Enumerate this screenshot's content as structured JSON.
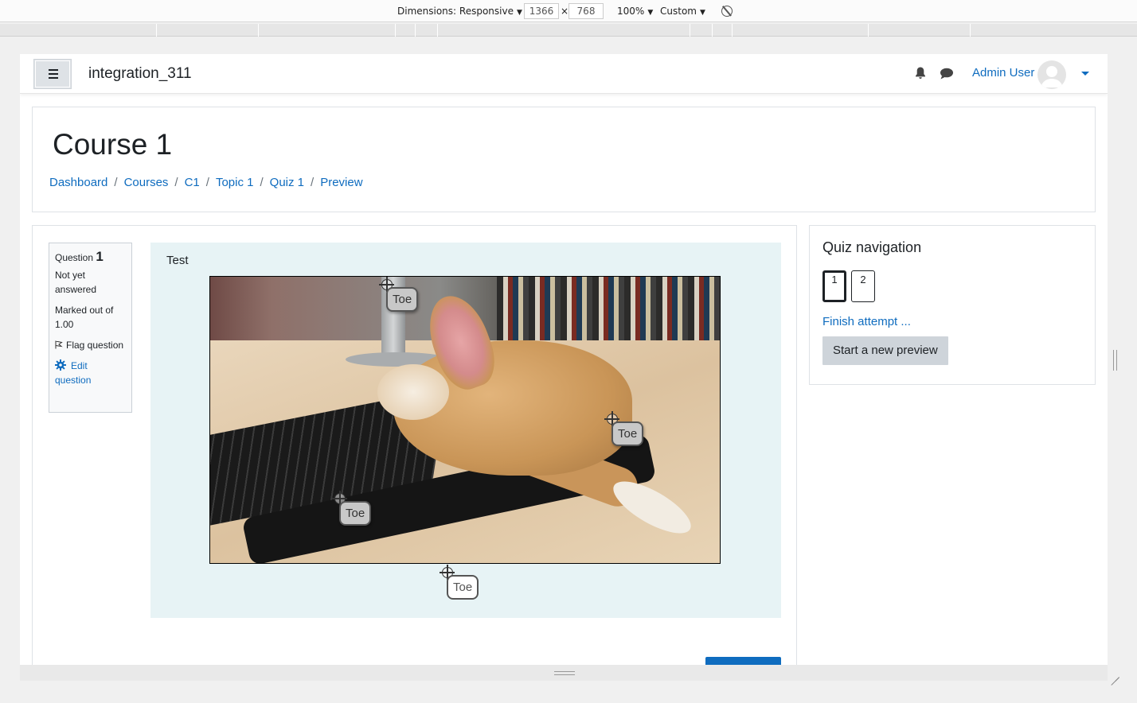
{
  "devtools": {
    "dimensions_label": "Dimensions: Responsive",
    "width_value": "1366",
    "times": "×",
    "height_value": "768",
    "zoom": "100%",
    "throttle": "Custom"
  },
  "navbar": {
    "site_name": "integration_311",
    "user_name": "Admin User",
    "icons": [
      "menu-icon",
      "bell-icon",
      "chat-icon",
      "avatar",
      "caret-down-icon"
    ]
  },
  "header": {
    "title": "Course 1",
    "breadcrumb": [
      "Dashboard",
      "Courses",
      "C1",
      "Topic 1",
      "Quiz 1",
      "Preview"
    ],
    "separator": "/"
  },
  "question_info": {
    "question_label": "Question",
    "question_number": "1",
    "state": "Not yet answered",
    "grade": "Marked out of 1.00",
    "flag": "Flag question",
    "edit": "Edit question"
  },
  "question": {
    "text": "Test",
    "markers": [
      "Toe",
      "Toe",
      "Toe",
      "Toe"
    ]
  },
  "quiz_navigation": {
    "title": "Quiz navigation",
    "buttons": [
      "1",
      "2"
    ],
    "finish": "Finish attempt ...",
    "new_preview": "Start a new preview"
  },
  "colors": {
    "link": "#0f6cbf",
    "question_bg": "#e7f3f5",
    "button_grey": "#ced4da"
  }
}
